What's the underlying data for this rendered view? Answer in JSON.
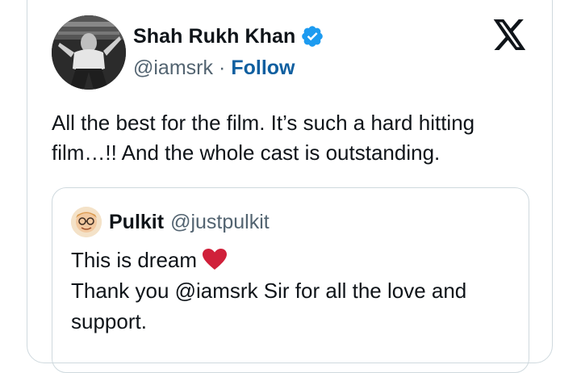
{
  "tweet": {
    "author": {
      "display_name": "Shah Rukh Khan",
      "handle": "@iamsrk",
      "separator": "·",
      "follow_label": "Follow",
      "verified": true
    },
    "text": "All the best for the film. It’s such a hard hitting film…!! And the whole cast is outstanding.",
    "logo_icon": "x-logo-icon"
  },
  "quoted_tweet": {
    "author": {
      "display_name": "Pulkit",
      "handle": "@justpulkit"
    },
    "line1": "This is dream",
    "line2": "Thank you @iamsrk Sir for all the love and support.",
    "emoji_icon": "red-heart-icon"
  },
  "colors": {
    "text_primary": "#0f1419",
    "text_secondary": "#536471",
    "follow_link": "#0f5fa0",
    "verified_badge": "#1d9bf0",
    "heart": "#d0203a",
    "border": "#cfd9de"
  }
}
